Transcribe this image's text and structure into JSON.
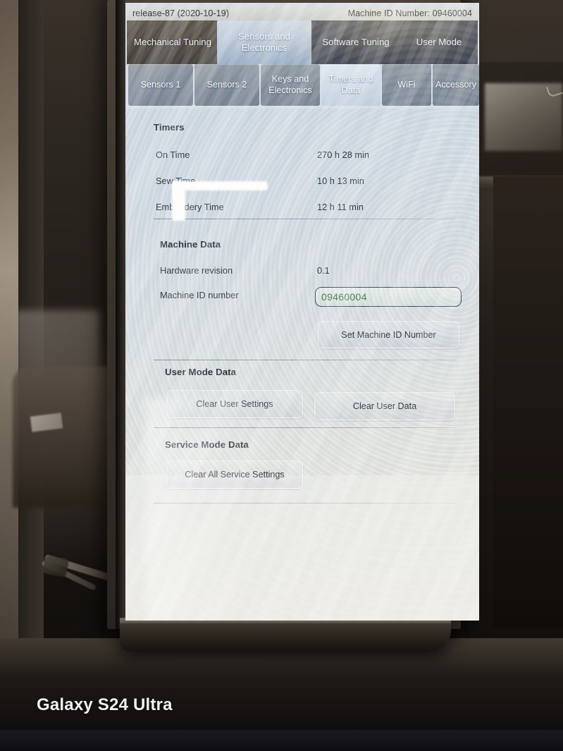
{
  "titlebar": {
    "release": "release-87 (2020-10-19)",
    "machine_id_label": "Machine ID Number: 09460004"
  },
  "primary_tabs": [
    {
      "label": "Mechanical Tuning",
      "active": false
    },
    {
      "label": "Sensors and Electronics",
      "active": true
    },
    {
      "label": "Software Tuning",
      "active": false
    },
    {
      "label": "User Mode",
      "active": false
    }
  ],
  "secondary_tabs": [
    {
      "label": "Sensors 1",
      "active": false
    },
    {
      "label": "Sensors 2",
      "active": false
    },
    {
      "label": "Keys and Electronics",
      "active": false
    },
    {
      "label": "Timers and Data",
      "active": true
    },
    {
      "label": "WiFi",
      "active": false
    },
    {
      "label": "Accessory",
      "active": false
    }
  ],
  "sections": {
    "timers": {
      "title": "Timers",
      "rows": [
        {
          "label": "On Time",
          "value": "270 h 28 min"
        },
        {
          "label": "Sew Time",
          "value": "10 h 13 min"
        },
        {
          "label": "Embroidery Time",
          "value": "12 h 11 min"
        }
      ]
    },
    "machine_data": {
      "title": "Machine Data",
      "rows": [
        {
          "label": "Hardware revision",
          "value": "0.1"
        },
        {
          "label": "Machine ID number",
          "value": ""
        }
      ],
      "id_input_value": "09460004",
      "set_id_button": "Set Machine ID Number"
    },
    "user_mode_data": {
      "title": "User Mode Data",
      "buttons": [
        {
          "label": "Clear User Settings"
        },
        {
          "label": "Clear User Data"
        }
      ]
    },
    "service_mode_data": {
      "title": "Service Mode Data",
      "buttons": [
        {
          "label": "Clear All Service Settings"
        }
      ]
    }
  },
  "watermark": "Galaxy S24 Ultra",
  "colors": {
    "id_text_green": "#2f6d3a",
    "id_border": "#2c3a5c",
    "tabbar_brown": "#463d33",
    "tabbar_blue": "#32343f",
    "active_tab": "#c9d2dd"
  }
}
